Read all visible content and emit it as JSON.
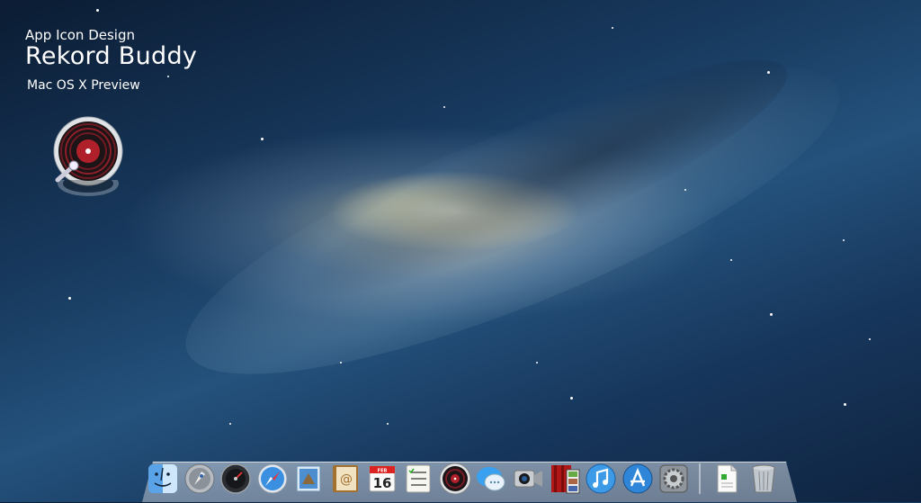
{
  "promo": {
    "kicker": "App Icon Design",
    "title": "Rekord Buddy",
    "subtitle": "Mac OS X Preview"
  },
  "hero_icon": {
    "icon": "vinyl-record-icon",
    "accent": "#b0202a"
  },
  "dock": {
    "items": [
      {
        "name": "Finder",
        "icon": "finder-icon"
      },
      {
        "name": "Launchpad",
        "icon": "launchpad-icon"
      },
      {
        "name": "Dashboard",
        "icon": "dashboard-icon"
      },
      {
        "name": "Safari",
        "icon": "safari-icon"
      },
      {
        "name": "Mail",
        "icon": "mail-icon"
      },
      {
        "name": "Contacts",
        "icon": "contacts-icon"
      },
      {
        "name": "Calendar",
        "icon": "calendar-icon",
        "month": "FEB",
        "day": "16"
      },
      {
        "name": "Reminders",
        "icon": "reminders-icon"
      },
      {
        "name": "Rekord Buddy",
        "icon": "vinyl-record-icon"
      },
      {
        "name": "Messages",
        "icon": "messages-icon"
      },
      {
        "name": "FaceTime",
        "icon": "facetime-icon"
      },
      {
        "name": "Photo Booth",
        "icon": "photo-booth-icon"
      },
      {
        "name": "iTunes",
        "icon": "itunes-icon"
      },
      {
        "name": "App Store",
        "icon": "app-store-icon"
      },
      {
        "name": "System Preferences",
        "icon": "system-preferences-icon"
      },
      {
        "name": "Document",
        "icon": "document-icon"
      },
      {
        "name": "Trash",
        "icon": "trash-icon"
      }
    ]
  }
}
